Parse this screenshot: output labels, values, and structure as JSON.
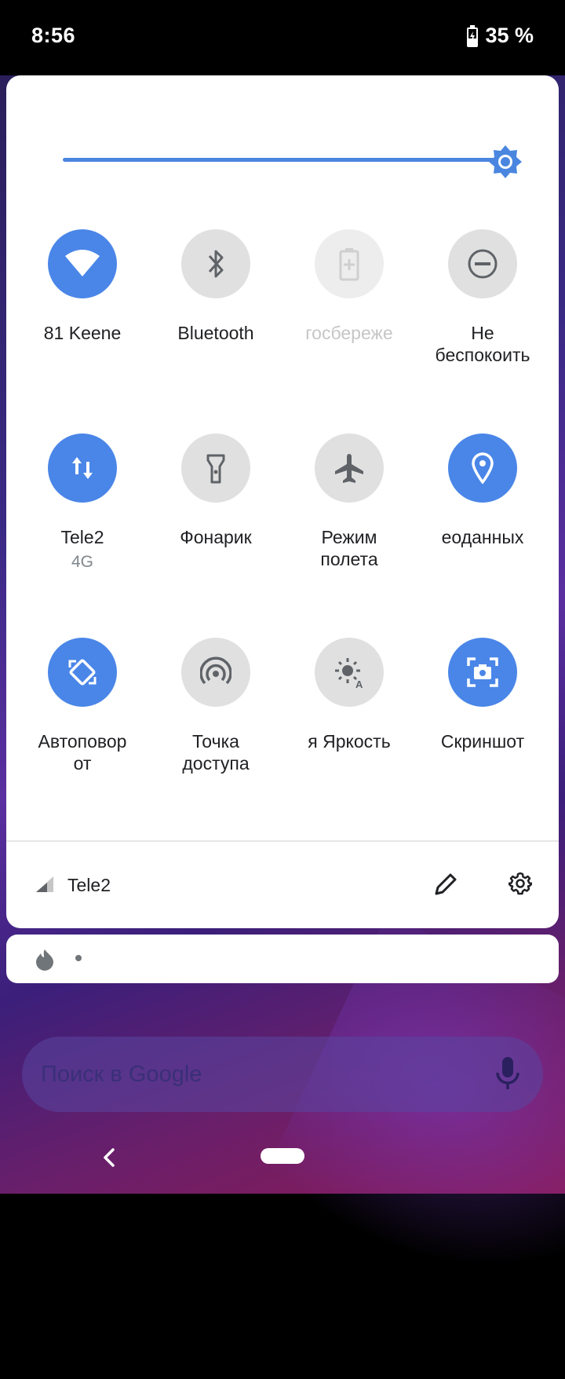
{
  "status_bar": {
    "time": "8:56",
    "battery": "35 %"
  },
  "quick_settings": {
    "tiles": [
      {
        "id": "wifi",
        "label": "81    Keene",
        "state": "on",
        "icon": "wifi-icon"
      },
      {
        "id": "bluetooth",
        "label": "Bluetooth",
        "state": "off",
        "icon": "bluetooth-icon"
      },
      {
        "id": "battery_saver",
        "label": "гоcбереже",
        "state": "disabled",
        "icon": "battery-saver-icon"
      },
      {
        "id": "dnd",
        "label": "Не\nбеспокоить",
        "state": "off",
        "icon": "do-not-disturb-icon"
      },
      {
        "id": "mobile_data",
        "label": "Tele2",
        "sublabel": "4G",
        "state": "on",
        "icon": "mobile-data-icon"
      },
      {
        "id": "flashlight",
        "label": "Фонарик",
        "state": "off",
        "icon": "flashlight-icon"
      },
      {
        "id": "airplane",
        "label": "Режим\nполета",
        "state": "off",
        "icon": "airplane-icon"
      },
      {
        "id": "location",
        "label": "еоданных",
        "state": "on",
        "icon": "location-icon"
      },
      {
        "id": "autorotate",
        "label": "Автоповор\nот",
        "state": "on",
        "icon": "autorotate-icon"
      },
      {
        "id": "hotspot",
        "label": "Точка\nдоступа",
        "state": "off",
        "icon": "hotspot-icon"
      },
      {
        "id": "brightness",
        "label": "я Яркость",
        "state": "off",
        "icon": "auto-brightness-icon"
      },
      {
        "id": "screenshot",
        "label": "Скриншот",
        "state": "on",
        "icon": "screenshot-icon"
      }
    ],
    "footer": {
      "carrier": "Tele2"
    },
    "brightness_level": 1.0
  },
  "search": {
    "placeholder": "Поиск в Google"
  },
  "colors": {
    "accent": "#4a86e8",
    "tile_off": "#e0e0e0"
  }
}
